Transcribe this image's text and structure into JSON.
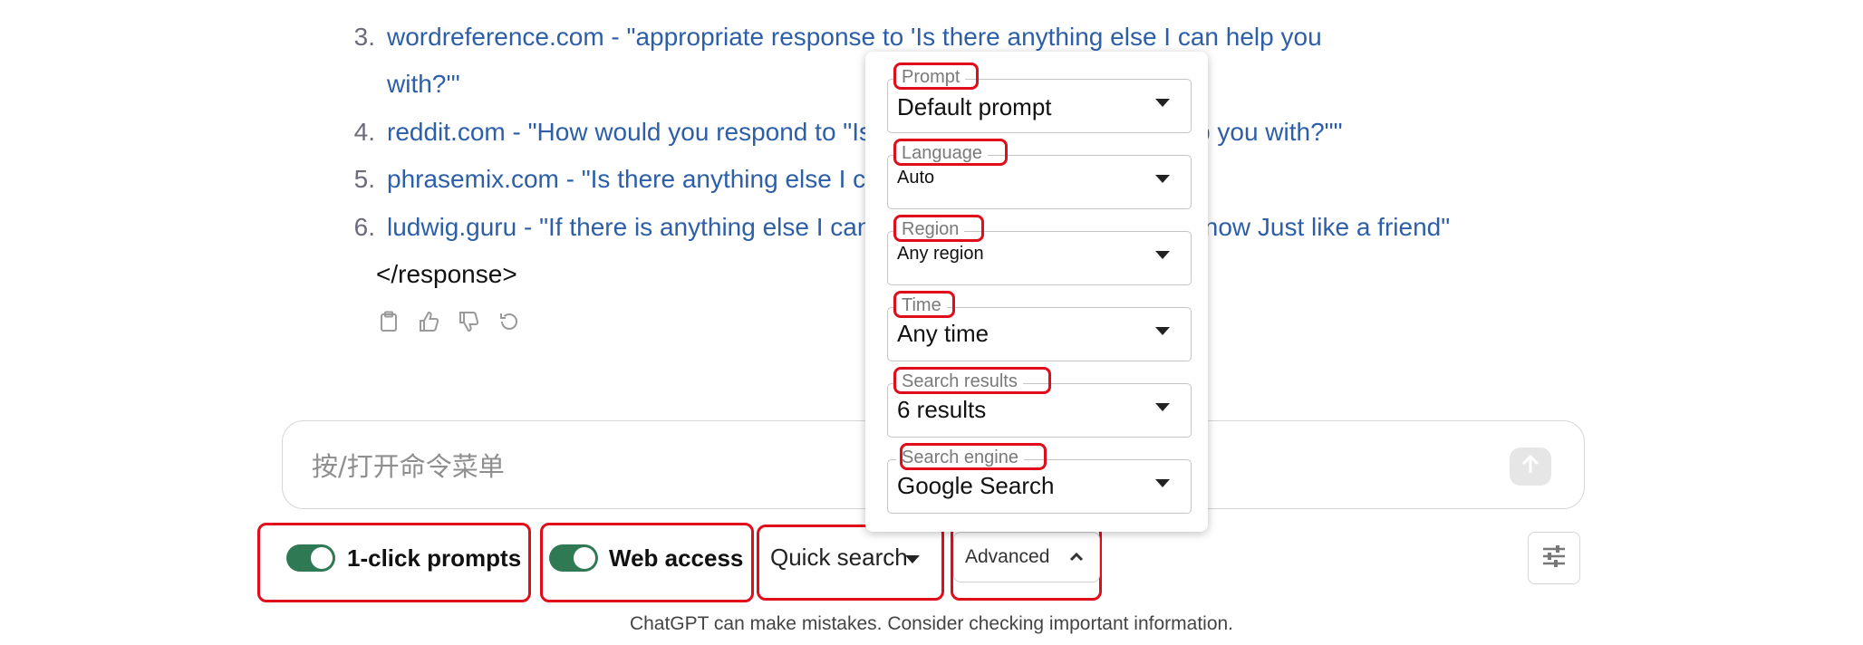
{
  "response": {
    "items": [
      {
        "number": "3.",
        "text": "wordreference.com - \"appropriate response to 'Is there anything else I can help you",
        "continuation": "with?'\""
      },
      {
        "number": "4.",
        "text": "reddit.com - \"How would you respond to \"Is there anything else I can help you with?\"\""
      },
      {
        "number": "5.",
        "text": "phrasemix.com - \"Is there anything else I can help you with?\""
      },
      {
        "number": "6.",
        "text": "ludwig.guru - \"If there is anything else I can help you with please let me know Just like a friend\""
      }
    ],
    "closing_tag": "</response>",
    "action_icons": [
      "clipboard-icon",
      "thumbs-up-icon",
      "thumbs-down-icon",
      "regenerate-icon"
    ]
  },
  "composer": {
    "placeholder": "按/打开命令菜单",
    "send_icon": "arrow-up-icon"
  },
  "controls": {
    "one_click_prompts": {
      "label": "1-click prompts",
      "on": true
    },
    "web_access": {
      "label": "Web access",
      "on": true
    },
    "quick_search": "Quick search",
    "advanced": "Advanced",
    "settings_icon": "sliders-icon"
  },
  "advanced_panel": {
    "fields": [
      {
        "label": "Prompt",
        "value": "Default prompt"
      },
      {
        "label": "Language",
        "value": "Auto"
      },
      {
        "label": "Region",
        "value": "Any region"
      },
      {
        "label": "Time",
        "value": "Any time"
      },
      {
        "label": "Search results",
        "value": "6 results"
      },
      {
        "label": "Search engine",
        "value": "Google Search"
      }
    ]
  },
  "disclaimer": "ChatGPT can make mistakes. Consider checking important information.",
  "colors": {
    "link": "#2d5fa8",
    "toggle_on": "#2f7a55",
    "annotation_red": "#e00d1a"
  }
}
